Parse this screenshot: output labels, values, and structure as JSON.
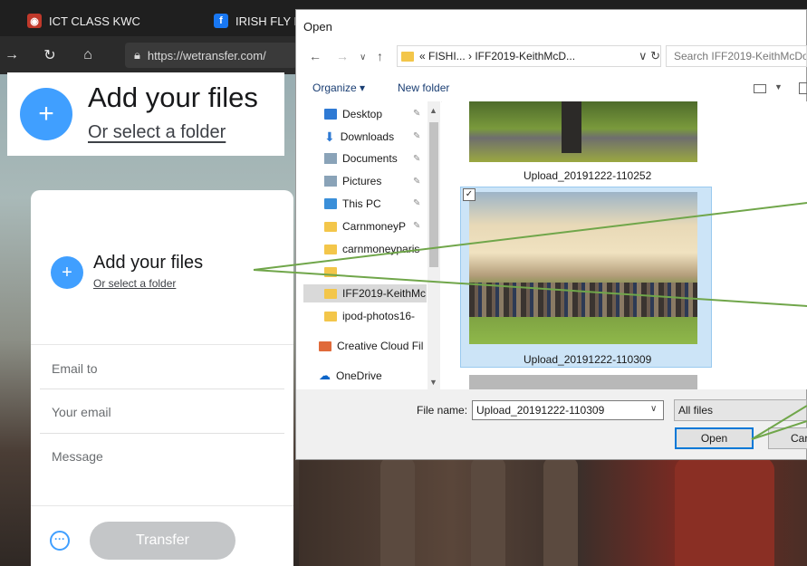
{
  "browser": {
    "tabs": [
      {
        "label": "ICT CLASS KWC",
        "icon": "owl-icon"
      },
      {
        "label": "IRISH FLY F",
        "icon": "facebook-icon"
      }
    ],
    "url": "https://wetransfer.com/"
  },
  "callout": {
    "title": "Add your files",
    "subtitle": "Or select a folder"
  },
  "wetransfer": {
    "add_title": "Add your files",
    "add_subtitle": "Or select a folder",
    "email_to": "Email to",
    "your_email": "Your email",
    "message": "Message",
    "transfer_label": "Transfer",
    "accent": "#409fff"
  },
  "dialog": {
    "title": "Open",
    "path": "« FISHI... › IFF2019-KeithMcD...",
    "search_placeholder": "Search IFF2019-KeithMcDo",
    "organize": "Organize ▾",
    "new_folder": "New folder",
    "nav_items": [
      {
        "label": "Desktop"
      },
      {
        "label": "Downloads"
      },
      {
        "label": "Documents"
      },
      {
        "label": "Pictures"
      },
      {
        "label": "This PC"
      },
      {
        "label": "CarnmoneyP"
      },
      {
        "label": "carnmoneyparis"
      },
      {
        "label": "IFF2019-KeithMc"
      },
      {
        "label": "ipod-photos16-"
      },
      {
        "label": "Creative Cloud Fil"
      },
      {
        "label": "OneDrive"
      }
    ],
    "files": [
      {
        "name": "Upload_20191222-110252"
      },
      {
        "name": "Upload_20191222-110309"
      }
    ],
    "file_name_label": "File name:",
    "file_name_value": "Upload_20191222-110309",
    "file_type": "All files",
    "open_label": "Open",
    "cancel_label": "Car"
  }
}
